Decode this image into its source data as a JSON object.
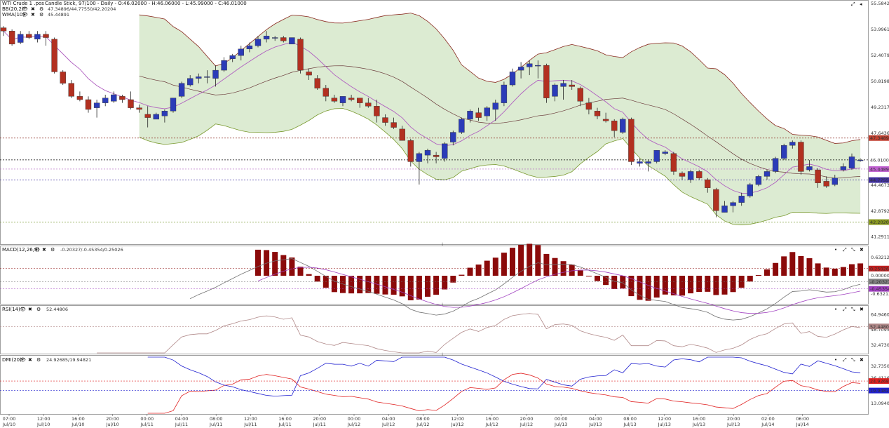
{
  "header": {
    "title": "WTI Crude 1 .pos",
    "info": "Candle Stick, 97/100 - Daily - O:46.02000 - H:46.06000 - L:45.99000 - C:46.01000"
  },
  "indicators": {
    "bb": {
      "label": "BB(20,2)",
      "values": "47.34896/44.77550/42.20204"
    },
    "wma": {
      "label": "WMA(10)",
      "values": "45.44891"
    },
    "macd": {
      "label": "MACD(12,26,9)",
      "values": "-0.20327/-0.45354/0.25026"
    },
    "rsi": {
      "label": "RSI(14)",
      "values": "52.44806"
    },
    "dmi": {
      "label": "DMI(20)",
      "values": "24.92685/19.94821"
    }
  },
  "colors": {
    "up": "#2b3bb8",
    "down": "#b23020",
    "bb_fill": "#dcebd2",
    "bb_upper": "#8a2a20",
    "bb_lower": "#7a9a30",
    "bb_mid": "#6a3a3a",
    "wma": "#b060c0",
    "macd_hist": "#8b0a0a",
    "macd_line": "#707070",
    "macd_signal": "#a040c0",
    "rsi_line": "#b08888",
    "dmi_plus": "#e02020",
    "dmi_minus": "#2020d0",
    "price_badge": "#ffffff"
  },
  "axes": {
    "price_ticks": [
      "55.58424",
      "53.99612",
      "52.40799",
      "50.81987",
      "49.23175",
      "47.64363",
      "46.05550",
      "44.46738",
      "42.87927",
      "41.29115"
    ],
    "macd_ticks": [
      "0.63212",
      "0.00000",
      "-0.63212"
    ],
    "rsi_ticks": [
      "64.94609",
      "48.70957",
      "32.47304"
    ],
    "dmi_ticks": [
      "32.73502",
      "26.41168",
      "13.09401"
    ],
    "x_time_labels": [
      "07:00",
      "12:00",
      "16:00",
      "20:00",
      "00:00",
      "04:00",
      "08:00",
      "12:00",
      "16:00",
      "20:00",
      "00:00",
      "04:00",
      "08:00",
      "12:00",
      "16:00",
      "20:00",
      "00:00",
      "04:00",
      "08:00",
      "12:00",
      "16:00",
      "20:00",
      "02:00",
      "06:00"
    ],
    "x_date_labels": [
      "Jul/10",
      "Jul/10",
      "Jul/10",
      "Jul/10",
      "Jul/11",
      "Jul/11",
      "Jul/11",
      "Jul/11",
      "Jul/11",
      "Jul/11",
      "Jul/12",
      "Jul/12",
      "Jul/12",
      "Jul/12",
      "Jul/12",
      "Jul/12",
      "Jul/13",
      "Jul/13",
      "Jul/13",
      "Jul/13",
      "Jul/13",
      "Jul/13",
      "Jul/14",
      "Jul/14"
    ]
  },
  "badges": {
    "bb_upper": "47.34896",
    "close": "46.01000",
    "wma": "45.44891",
    "bb_mid": "44.77550",
    "bb_lower": "42.20204",
    "macd_hist": "0.25026",
    "macd_line": "-0.20327",
    "macd_signal": "-0.45354",
    "rsi": "52.44806",
    "dmi_plus": "24.92685",
    "dmi_minus": "19.94821"
  },
  "chart_data": {
    "type": "candlestick",
    "series_ohlc": [
      [
        54.1,
        54.2,
        53.6,
        53.9
      ],
      [
        53.9,
        54.0,
        53.0,
        53.1
      ],
      [
        53.2,
        53.9,
        53.1,
        53.7
      ],
      [
        53.7,
        53.9,
        53.4,
        53.5
      ],
      [
        53.4,
        53.9,
        53.2,
        53.7
      ],
      [
        53.7,
        53.9,
        53.0,
        53.5
      ],
      [
        53.4,
        53.5,
        51.3,
        51.4
      ],
      [
        51.4,
        51.5,
        50.6,
        50.7
      ],
      [
        50.7,
        50.9,
        49.8,
        49.9
      ],
      [
        49.9,
        50.2,
        49.6,
        49.7
      ],
      [
        49.7,
        49.9,
        48.9,
        49.1
      ],
      [
        49.2,
        49.7,
        48.6,
        49.5
      ],
      [
        49.5,
        50.0,
        49.3,
        49.8
      ],
      [
        49.6,
        50.2,
        49.5,
        50.0
      ],
      [
        49.9,
        50.0,
        49.5,
        49.7
      ],
      [
        49.7,
        50.2,
        49.1,
        49.2
      ],
      [
        49.2,
        49.4,
        48.9,
        49.1
      ],
      [
        48.8,
        49.3,
        48.0,
        48.6
      ],
      [
        48.5,
        48.9,
        48.5,
        48.8
      ],
      [
        48.7,
        49.1,
        48.3,
        49.0
      ],
      [
        49.0,
        49.8,
        48.9,
        49.8
      ],
      [
        49.9,
        50.8,
        49.8,
        50.7
      ],
      [
        50.6,
        51.2,
        50.5,
        51.0
      ],
      [
        51.0,
        51.3,
        50.7,
        51.1
      ],
      [
        51.1,
        51.5,
        50.7,
        51.1
      ],
      [
        51.0,
        51.8,
        50.5,
        51.5
      ],
      [
        51.5,
        52.3,
        51.4,
        52.1
      ],
      [
        52.2,
        52.5,
        52.0,
        52.4
      ],
      [
        52.4,
        53.0,
        52.1,
        52.8
      ],
      [
        52.8,
        53.2,
        52.6,
        53.0
      ],
      [
        53.0,
        53.6,
        52.9,
        53.4
      ],
      [
        53.4,
        53.9,
        53.2,
        53.6
      ],
      [
        53.5,
        53.6,
        53.3,
        53.5
      ],
      [
        53.5,
        53.6,
        53.2,
        53.3
      ],
      [
        53.1,
        53.5,
        53.1,
        53.5
      ],
      [
        53.4,
        53.5,
        51.3,
        51.5
      ],
      [
        51.4,
        51.6,
        50.9,
        51.2
      ],
      [
        51.0,
        51.2,
        50.3,
        50.4
      ],
      [
        50.4,
        50.6,
        49.6,
        49.9
      ],
      [
        49.8,
        50.0,
        49.5,
        49.6
      ],
      [
        49.5,
        49.9,
        49.3,
        49.9
      ],
      [
        49.8,
        50.0,
        49.6,
        49.7
      ],
      [
        49.8,
        49.8,
        49.2,
        49.5
      ],
      [
        49.5,
        49.8,
        49.2,
        49.3
      ],
      [
        49.3,
        49.7,
        48.3,
        48.7
      ],
      [
        48.6,
        48.8,
        48.1,
        48.3
      ],
      [
        48.3,
        48.6,
        47.9,
        48.0
      ],
      [
        47.9,
        48.1,
        47.2,
        47.2
      ],
      [
        47.2,
        47.3,
        45.6,
        45.9
      ],
      [
        45.9,
        46.5,
        44.5,
        46.4
      ],
      [
        46.3,
        46.7,
        45.8,
        46.6
      ],
      [
        46.3,
        46.5,
        45.8,
        46.2
      ],
      [
        46.1,
        47.1,
        45.9,
        47.0
      ],
      [
        47.1,
        47.8,
        46.9,
        47.7
      ],
      [
        47.7,
        48.6,
        47.6,
        48.5
      ],
      [
        48.5,
        49.1,
        48.3,
        49.0
      ],
      [
        48.9,
        49.2,
        48.4,
        48.6
      ],
      [
        48.7,
        49.3,
        48.4,
        49.2
      ],
      [
        49.1,
        49.7,
        48.4,
        49.5
      ],
      [
        49.5,
        50.8,
        49.3,
        50.6
      ],
      [
        50.6,
        51.6,
        50.5,
        51.4
      ],
      [
        51.5,
        52.0,
        51.0,
        51.7
      ],
      [
        51.7,
        52.1,
        51.2,
        51.9
      ],
      [
        51.8,
        52.1,
        51.0,
        51.8
      ],
      [
        51.8,
        51.9,
        49.5,
        49.8
      ],
      [
        49.9,
        50.7,
        49.6,
        50.6
      ],
      [
        50.5,
        50.9,
        49.7,
        50.7
      ],
      [
        50.6,
        50.9,
        50.3,
        50.5
      ],
      [
        50.4,
        50.5,
        49.3,
        49.6
      ],
      [
        49.5,
        49.8,
        48.8,
        49.1
      ],
      [
        49.0,
        49.2,
        48.5,
        48.7
      ],
      [
        48.5,
        48.9,
        48.3,
        48.4
      ],
      [
        48.4,
        48.5,
        47.4,
        47.8
      ],
      [
        47.7,
        48.6,
        47.6,
        48.5
      ],
      [
        48.5,
        48.6,
        45.7,
        45.9
      ],
      [
        45.8,
        46.1,
        45.6,
        45.9
      ],
      [
        45.8,
        46.0,
        45.3,
        45.9
      ],
      [
        45.9,
        46.6,
        45.8,
        46.6
      ],
      [
        46.4,
        46.6,
        46.3,
        46.5
      ],
      [
        46.4,
        46.5,
        45.1,
        45.3
      ],
      [
        45.2,
        45.3,
        44.8,
        45.0
      ],
      [
        44.8,
        45.4,
        44.6,
        45.3
      ],
      [
        45.3,
        45.4,
        44.8,
        44.9
      ],
      [
        44.8,
        44.9,
        44.0,
        44.3
      ],
      [
        44.2,
        44.3,
        42.5,
        42.9
      ],
      [
        42.8,
        43.5,
        42.8,
        43.2
      ],
      [
        43.2,
        43.5,
        42.8,
        43.4
      ],
      [
        43.4,
        44.0,
        43.2,
        43.8
      ],
      [
        43.8,
        44.6,
        43.7,
        44.5
      ],
      [
        44.5,
        45.1,
        44.4,
        45.0
      ],
      [
        45.0,
        45.4,
        44.8,
        45.3
      ],
      [
        45.3,
        46.2,
        45.2,
        46.1
      ],
      [
        46.1,
        47.0,
        46.0,
        46.9
      ],
      [
        46.9,
        47.2,
        46.7,
        47.1
      ],
      [
        47.1,
        47.2,
        45.1,
        45.3
      ],
      [
        45.4,
        46.0,
        45.3,
        45.6
      ],
      [
        45.4,
        45.5,
        44.3,
        44.6
      ],
      [
        44.7,
        45.0,
        44.3,
        44.4
      ],
      [
        44.5,
        45.1,
        44.4,
        44.9
      ],
      [
        45.4,
        45.8,
        45.3,
        45.6
      ],
      [
        45.5,
        46.4,
        45.4,
        46.2
      ],
      [
        46.0,
        46.1,
        45.9,
        46.0
      ]
    ],
    "bb_upper": [],
    "bb_mid": [],
    "bb_lower": [],
    "wma": [],
    "macd_hist": [],
    "macd_line": [],
    "macd_signal": [],
    "rsi": [],
    "dmi_plus": [],
    "dmi_minus": [],
    "levels": {
      "bb_upper": 47.34896,
      "close": 46.01,
      "wma": 45.44891,
      "bb_mid": 44.7755,
      "bb_lower": 42.20204
    },
    "price_range": [
      40.85,
      55.8
    ],
    "macd_range": [
      -0.95,
      1.0
    ],
    "rsi_range": [
      24.0,
      73.0
    ],
    "dmi_range": [
      8.0,
      37.5
    ]
  }
}
